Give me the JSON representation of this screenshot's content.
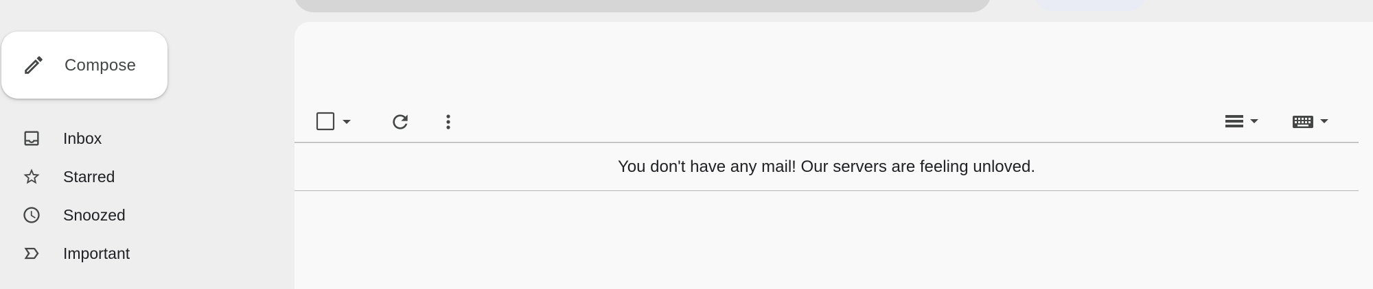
{
  "compose": {
    "label": "Compose",
    "icon": "pencil-icon"
  },
  "sidebar": {
    "items": [
      {
        "label": "Inbox",
        "icon": "inbox-icon"
      },
      {
        "label": "Starred",
        "icon": "star-icon"
      },
      {
        "label": "Snoozed",
        "icon": "clock-icon"
      },
      {
        "label": "Important",
        "icon": "important-icon"
      }
    ]
  },
  "toolbar": {
    "select_icon": "checkbox-icon",
    "select_menu_icon": "caret-down-icon",
    "refresh_icon": "refresh-icon",
    "more_icon": "more-vert-icon",
    "density_icon": "density-icon",
    "input_tools_icon": "keyboard-icon"
  },
  "main": {
    "empty_message": "You don't have any mail! Our servers are feeling unloved."
  },
  "colors": {
    "background": "#eeeeee",
    "panel": "#f9f9f9",
    "compose_bg": "#ffffff",
    "icon": "#444746",
    "text": "#202124"
  }
}
